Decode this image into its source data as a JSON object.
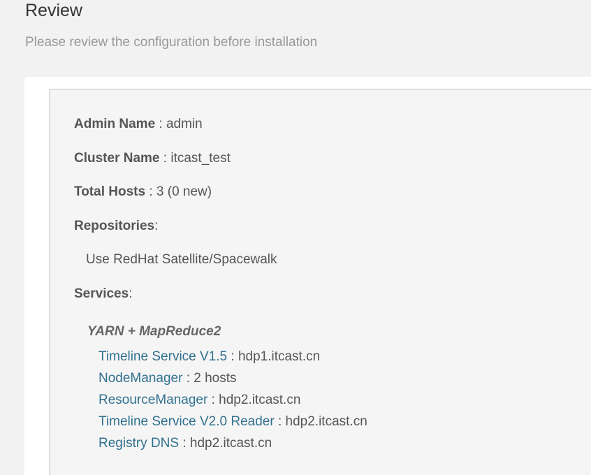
{
  "header": {
    "title": "Review",
    "subtitle": "Please review the configuration before installation"
  },
  "summary": {
    "admin_name": {
      "label": "Admin Name",
      "sep": " : ",
      "value": "admin"
    },
    "cluster_name": {
      "label": "Cluster Name",
      "sep": " : ",
      "value": "itcast_test"
    },
    "total_hosts": {
      "label": "Total Hosts",
      "sep": " : ",
      "value": "3 (0 new)"
    },
    "repositories": {
      "label": "Repositories",
      "sep": ":",
      "value": "Use RedHat Satellite/Spacewalk"
    },
    "services": {
      "label": "Services",
      "sep": ":"
    }
  },
  "services": [
    {
      "name": "YARN + MapReduce2",
      "components": [
        {
          "name": "Timeline Service V1.5",
          "sep": " : ",
          "value": "hdp1.itcast.cn"
        },
        {
          "name": "NodeManager",
          "sep": " : ",
          "value": "2 hosts"
        },
        {
          "name": "ResourceManager",
          "sep": " : ",
          "value": "hdp2.itcast.cn"
        },
        {
          "name": "Timeline Service V2.0 Reader",
          "sep": " : ",
          "value": "hdp2.itcast.cn"
        },
        {
          "name": "Registry DNS",
          "sep": " : ",
          "value": "hdp2.itcast.cn"
        }
      ]
    }
  ],
  "colors": {
    "link": "#31708f",
    "text": "#555555",
    "subtitle": "#999999",
    "background": "#f2f2f2"
  }
}
